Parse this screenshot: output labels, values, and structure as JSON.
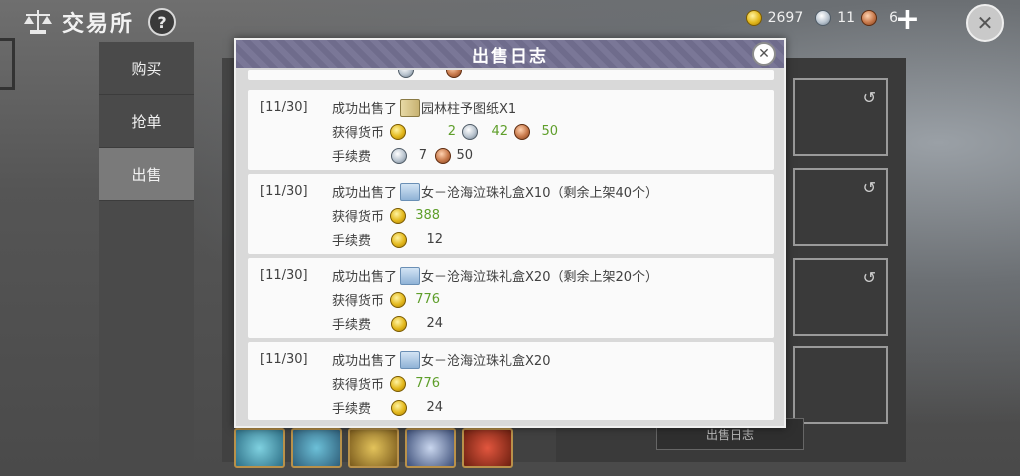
{
  "header": {
    "title": "交易所",
    "help_label": "?",
    "gold": "2697",
    "silver": "11",
    "bronze": "6",
    "add_label": "+",
    "close_label": "✕"
  },
  "sidebar": {
    "items": [
      {
        "label": "购买"
      },
      {
        "label": "抢单"
      },
      {
        "label": "出售"
      }
    ],
    "active_index": 2
  },
  "background": {
    "log_button_label": "出售日志"
  },
  "modal": {
    "title": "出售日志",
    "close_label": "✕",
    "entries": [
      {
        "date": "[11/30]",
        "action": "成功出售了",
        "item": "园林柱予图纸X1",
        "earned_label": "获得货币",
        "earned": {
          "gold": "2",
          "silver": "42",
          "bronze": "50"
        },
        "fee_label": "手续费",
        "fee": {
          "silver": "7",
          "bronze": "50"
        }
      },
      {
        "date": "[11/30]",
        "action": "成功出售了",
        "item": "女－沧海泣珠礼盒X10（剩余上架40个）",
        "earned_label": "获得货币",
        "earned": {
          "gold": "388"
        },
        "fee_label": "手续费",
        "fee": {
          "gold": "12"
        }
      },
      {
        "date": "[11/30]",
        "action": "成功出售了",
        "item": "女－沧海泣珠礼盒X20（剩余上架20个）",
        "earned_label": "获得货币",
        "earned": {
          "gold": "776"
        },
        "fee_label": "手续费",
        "fee": {
          "gold": "24"
        }
      },
      {
        "date": "[11/30]",
        "action": "成功出售了",
        "item": "女－沧海泣珠礼盒X20",
        "earned_label": "获得货币",
        "earned": {
          "gold": "776"
        },
        "fee_label": "手续费",
        "fee": {
          "gold": "24"
        }
      }
    ]
  },
  "colors": {
    "earned_value": "#5e9e2a",
    "modal_header": "#6f6c8c",
    "entry_bg": "#fafafa"
  },
  "icons": [
    "scale-icon",
    "help-icon",
    "gold-coin-icon",
    "silver-coin-icon",
    "bronze-coin-icon",
    "plus-icon",
    "close-icon",
    "refresh-icon",
    "blueprint-icon",
    "gift-box-icon"
  ]
}
